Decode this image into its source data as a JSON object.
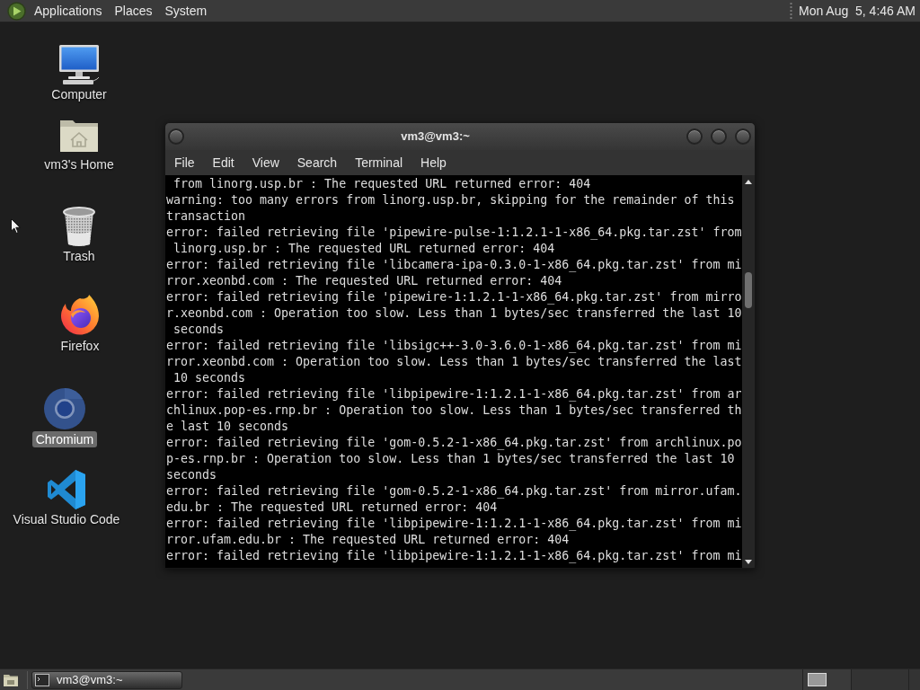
{
  "top_panel": {
    "menus": [
      "Applications",
      "Places",
      "System"
    ],
    "clock": "Mon Aug  5, 4:46 AM"
  },
  "desktop_icons": [
    {
      "label": "Computer",
      "kind": "computer",
      "selected": false
    },
    {
      "label": "vm3's Home",
      "kind": "home",
      "selected": false
    },
    {
      "label": "Trash",
      "kind": "trash",
      "selected": false
    },
    {
      "label": "Firefox",
      "kind": "firefox",
      "selected": false
    },
    {
      "label": "Chromium",
      "kind": "chromium",
      "selected": true
    },
    {
      "label": "Visual Studio Code",
      "kind": "vscode",
      "selected": false
    }
  ],
  "terminal_window": {
    "title": "vm3@vm3:~",
    "menus": [
      "File",
      "Edit",
      "View",
      "Search",
      "Terminal",
      "Help"
    ],
    "lines": [
      " from linorg.usp.br : The requested URL returned error: 404",
      "warning: too many errors from linorg.usp.br, skipping for the remainder of this",
      "transaction",
      "error: failed retrieving file 'pipewire-pulse-1:1.2.1-1-x86_64.pkg.tar.zst' from",
      " linorg.usp.br : The requested URL returned error: 404",
      "error: failed retrieving file 'libcamera-ipa-0.3.0-1-x86_64.pkg.tar.zst' from mi",
      "rror.xeonbd.com : The requested URL returned error: 404",
      "error: failed retrieving file 'pipewire-1:1.2.1-1-x86_64.pkg.tar.zst' from mirro",
      "r.xeonbd.com : Operation too slow. Less than 1 bytes/sec transferred the last 10",
      " seconds",
      "error: failed retrieving file 'libsigc++-3.0-3.6.0-1-x86_64.pkg.tar.zst' from mi",
      "rror.xeonbd.com : Operation too slow. Less than 1 bytes/sec transferred the last",
      " 10 seconds",
      "error: failed retrieving file 'libpipewire-1:1.2.1-1-x86_64.pkg.tar.zst' from ar",
      "chlinux.pop-es.rnp.br : Operation too slow. Less than 1 bytes/sec transferred th",
      "e last 10 seconds",
      "error: failed retrieving file 'gom-0.5.2-1-x86_64.pkg.tar.zst' from archlinux.po",
      "p-es.rnp.br : Operation too slow. Less than 1 bytes/sec transferred the last 10",
      "seconds",
      "error: failed retrieving file 'gom-0.5.2-1-x86_64.pkg.tar.zst' from mirror.ufam.",
      "edu.br : The requested URL returned error: 404",
      "error: failed retrieving file 'libpipewire-1:1.2.1-1-x86_64.pkg.tar.zst' from mi",
      "rror.ufam.edu.br : The requested URL returned error: 404",
      "error: failed retrieving file 'libpipewire-1:1.2.1-1-x86_64.pkg.tar.zst' from mi"
    ]
  },
  "bottom_panel": {
    "windows": [
      {
        "title": "vm3@vm3:~"
      }
    ]
  }
}
